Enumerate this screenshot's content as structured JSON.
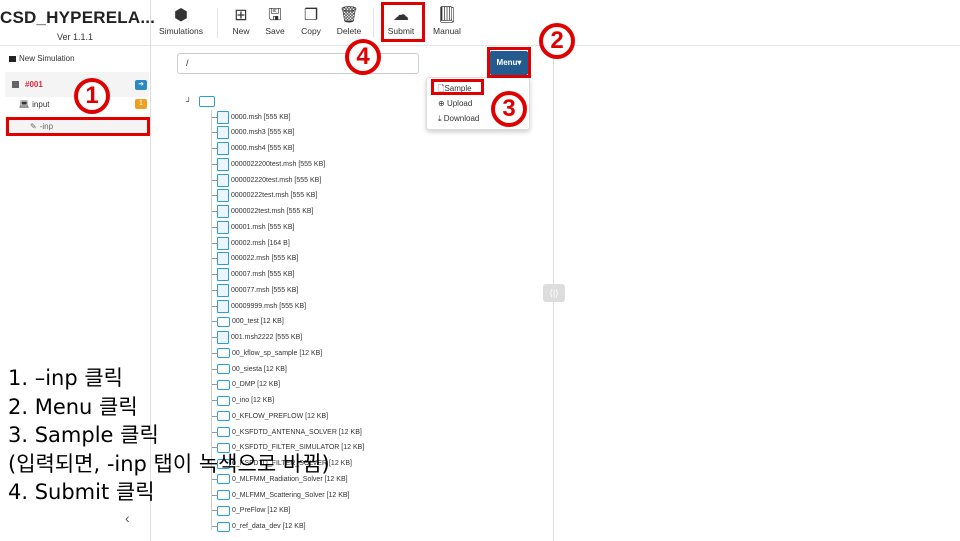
{
  "app": {
    "title": "CSD_HYPERELA...",
    "version": "Ver 1.1.1"
  },
  "sidebar": {
    "new_simulation": "New Simulation",
    "sim_id": "#001",
    "input_label": "input",
    "input_badge": "1",
    "inp_label": "-inp",
    "collapse": "‹"
  },
  "toolbar": {
    "simulations": "Simulations",
    "new": "New",
    "save": "Save",
    "copy": "Copy",
    "delete": "Delete",
    "submit": "Submit",
    "manual": "Manual"
  },
  "path": {
    "value": "/"
  },
  "menu": {
    "label": "Menu▾",
    "items": [
      "Sample",
      "Upload",
      "Download"
    ]
  },
  "tree": {
    "files": [
      {
        "name": "0000.msh [555 KB]",
        "type": "file"
      },
      {
        "name": "0000.msh3 [555 KB]",
        "type": "file"
      },
      {
        "name": "0000.msh4 [555 KB]",
        "type": "file"
      },
      {
        "name": "0000022200test.msh [555 KB]",
        "type": "file"
      },
      {
        "name": "000002220test.msh [555 KB]",
        "type": "file"
      },
      {
        "name": "00000222test.msh [555 KB]",
        "type": "file"
      },
      {
        "name": "0000022test.msh [555 KB]",
        "type": "file"
      },
      {
        "name": "00001.msh [555 KB]",
        "type": "file"
      },
      {
        "name": "00002.msh [164 B]",
        "type": "file"
      },
      {
        "name": "000022.msh [555 KB]",
        "type": "file"
      },
      {
        "name": "00007.msh [555 KB]",
        "type": "file"
      },
      {
        "name": "000077.msh [555 KB]",
        "type": "file"
      },
      {
        "name": "00009999.msh [555 KB]",
        "type": "file"
      },
      {
        "name": "000_test [12 KB]",
        "type": "folder"
      },
      {
        "name": "001.msh2222 [555 KB]",
        "type": "file"
      },
      {
        "name": "00_kflow_sp_sample [12 KB]",
        "type": "folder"
      },
      {
        "name": "00_siesta [12 KB]",
        "type": "folder"
      },
      {
        "name": "0_DMP [12 KB]",
        "type": "folder"
      },
      {
        "name": "0_ino [12 KB]",
        "type": "folder"
      },
      {
        "name": "0_KFLOW_PREFLOW [12 KB]",
        "type": "folder"
      },
      {
        "name": "0_KSFDTD_ANTENNA_SOLVER [12 KB]",
        "type": "folder"
      },
      {
        "name": "0_KSFDTD_FILTER_SIMULATOR [12 KB]",
        "type": "folder"
      },
      {
        "name": "0_KSFDTD_FILTER_SOLVER [12 KB]",
        "type": "folder"
      },
      {
        "name": "0_MLFMM_Radiation_Solver [12 KB]",
        "type": "folder"
      },
      {
        "name": "0_MLFMM_Scattering_Solver [12 KB]",
        "type": "folder"
      },
      {
        "name": "0_PreFlow [12 KB]",
        "type": "folder"
      },
      {
        "name": "0_ref_data_dev [12 KB]",
        "type": "folder"
      }
    ]
  },
  "annotations": {
    "c1": "1",
    "c2": "2",
    "c3": "3",
    "c4": "4",
    "instructions": [
      "1. –inp 클릭",
      "2. Menu 클릭",
      "3. Sample 클릭",
      "(입력되면, -inp 탭이 녹색으로 바뀜)",
      "4. Submit 클릭"
    ]
  },
  "colors": {
    "accent": "#245b8f",
    "annotation": "#e00000",
    "sim_id": "#d9263c"
  }
}
